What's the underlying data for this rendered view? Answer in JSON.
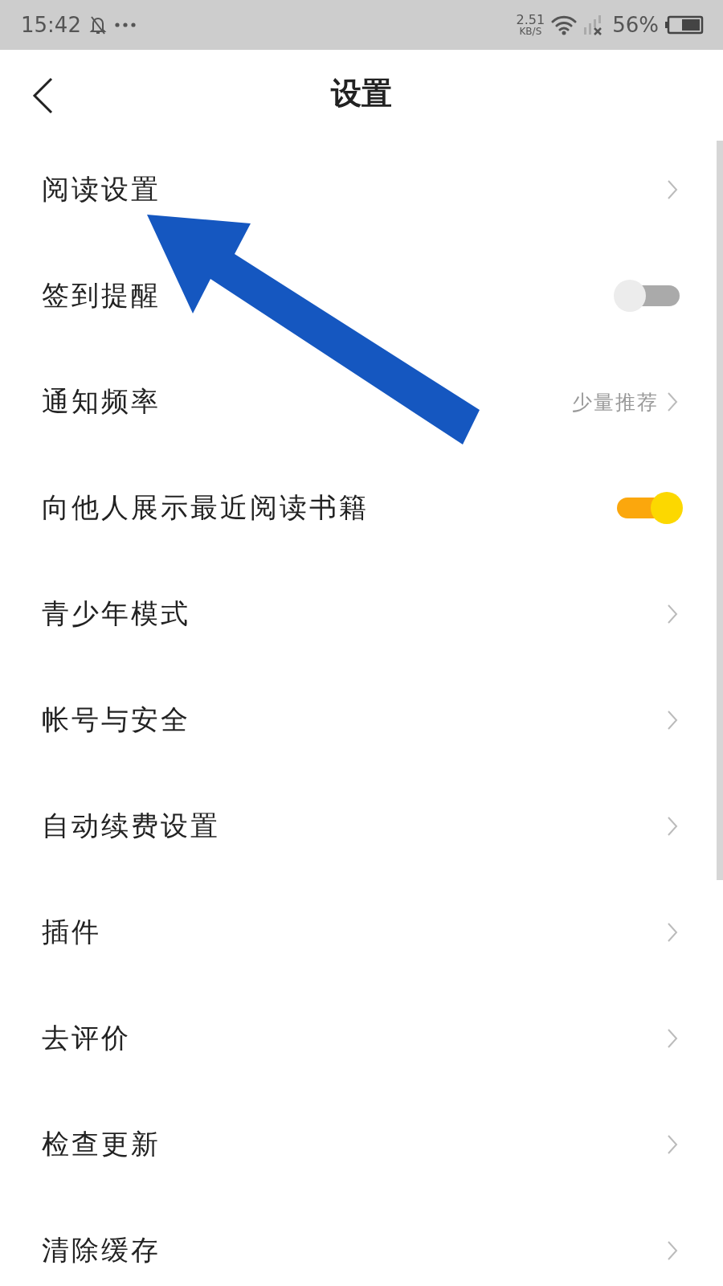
{
  "status_bar": {
    "time": "15:42",
    "speed": "2.51",
    "speed_unit": "KB/S",
    "battery": "56%"
  },
  "header": {
    "title": "设置"
  },
  "settings": [
    {
      "kind": "link",
      "label": "阅读设置"
    },
    {
      "kind": "toggle",
      "label": "签到提醒",
      "on": false
    },
    {
      "kind": "value",
      "label": "通知频率",
      "value": "少量推荐"
    },
    {
      "kind": "toggle",
      "label": "向他人展示最近阅读书籍",
      "on": true
    },
    {
      "kind": "link",
      "label": "青少年模式"
    },
    {
      "kind": "link",
      "label": "帐号与安全"
    },
    {
      "kind": "link",
      "label": "自动续费设置"
    },
    {
      "kind": "link",
      "label": "插件"
    },
    {
      "kind": "link",
      "label": "去评价"
    },
    {
      "kind": "link",
      "label": "检查更新"
    },
    {
      "kind": "link",
      "label": "清除缓存"
    }
  ]
}
